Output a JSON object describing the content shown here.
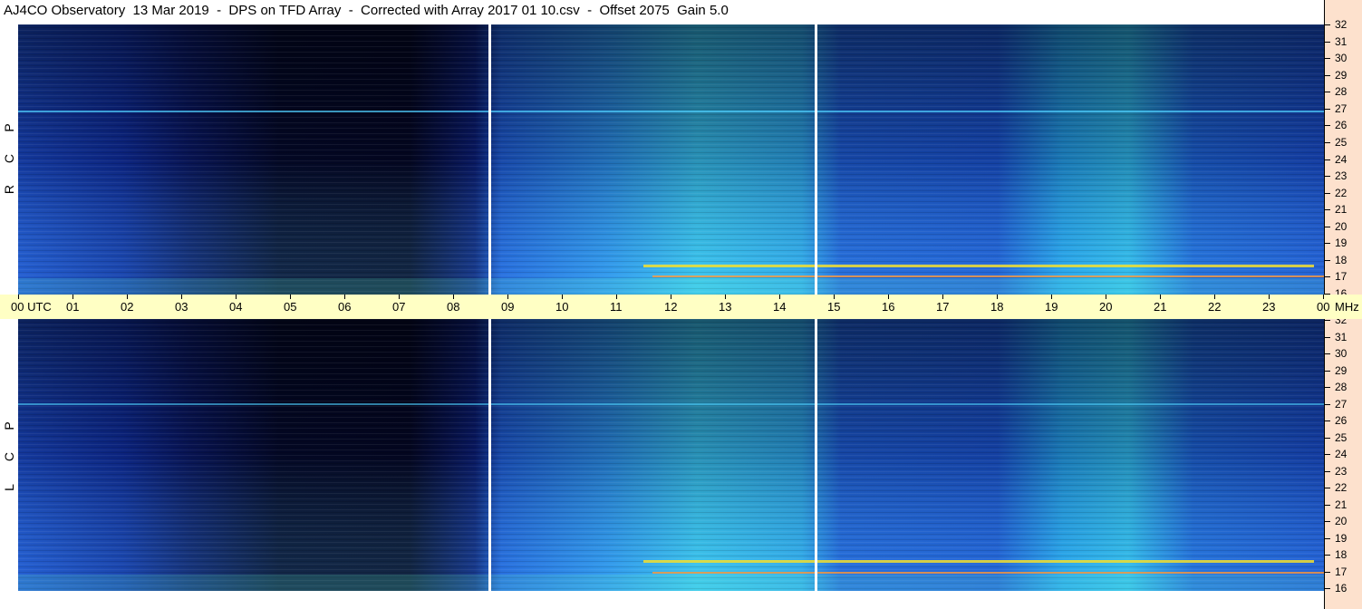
{
  "header": {
    "title": "AJ4CO Observatory  13 Mar 2019  -  DPS on TFD Array  -  Corrected with Array 2017 01 10.csv  -  Offset 2075  Gain 5.0"
  },
  "panels": [
    {
      "id": "rcp",
      "polarization_letters": [
        "R",
        "C",
        "P"
      ]
    },
    {
      "id": "lcp",
      "polarization_letters": [
        "L",
        "C",
        "P"
      ]
    }
  ],
  "time_axis": {
    "labels": [
      "00 UTC",
      "01",
      "02",
      "03",
      "04",
      "05",
      "06",
      "07",
      "08",
      "09",
      "10",
      "11",
      "12",
      "13",
      "14",
      "15",
      "16",
      "17",
      "18",
      "19",
      "20",
      "21",
      "22",
      "23",
      "00"
    ]
  },
  "freq_axis": {
    "unit_label": "MHz",
    "labels": [
      "32",
      "31",
      "30",
      "29",
      "28",
      "27",
      "26",
      "25",
      "24",
      "23",
      "22",
      "21",
      "20",
      "19",
      "18",
      "17",
      "16"
    ]
  },
  "colors": {
    "background_dark": "#050a3a",
    "spectrum_mid": "#1556d8",
    "spectrum_bright": "#28c8f0",
    "time_strip": "#ffffc4",
    "freq_axis_bg": "#fde1cd"
  }
}
